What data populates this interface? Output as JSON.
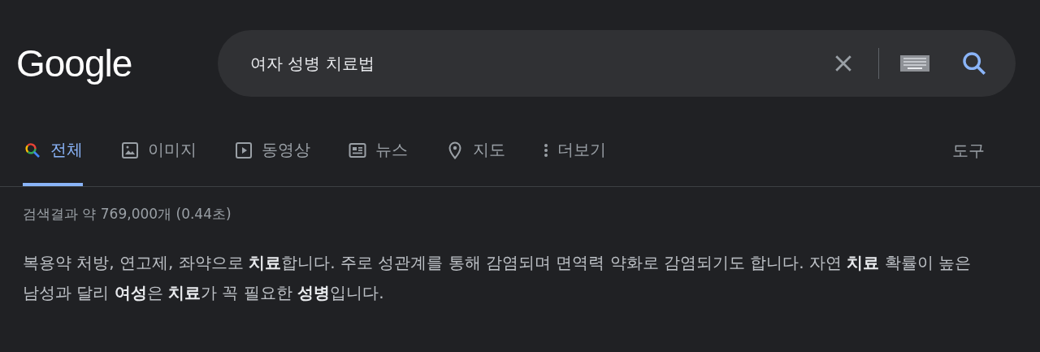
{
  "logo": "Google",
  "search": {
    "value": "여자 성병 치료법"
  },
  "tabs": [
    {
      "label": "전체",
      "kind": "all",
      "selected": true
    },
    {
      "label": "이미지",
      "kind": "images",
      "selected": false
    },
    {
      "label": "동영상",
      "kind": "videos",
      "selected": false
    },
    {
      "label": "뉴스",
      "kind": "news",
      "selected": false
    },
    {
      "label": "지도",
      "kind": "maps",
      "selected": false
    },
    {
      "label": "더보기",
      "kind": "more",
      "selected": false
    }
  ],
  "tools": "도구",
  "result_stats": "검색결과 약 769,000개 (0.44초)",
  "snippet": "복용약 처방, 연고제, 좌약으로 **치료**합니다. 주로 성관계를 통해 감염되며 면역력 약화로 감염되기도 합니다. 자연 **치료** 확률이 높은 남성과 달리 **여성**은 **치료**가 꼭 필요한 **성병**입니다."
}
